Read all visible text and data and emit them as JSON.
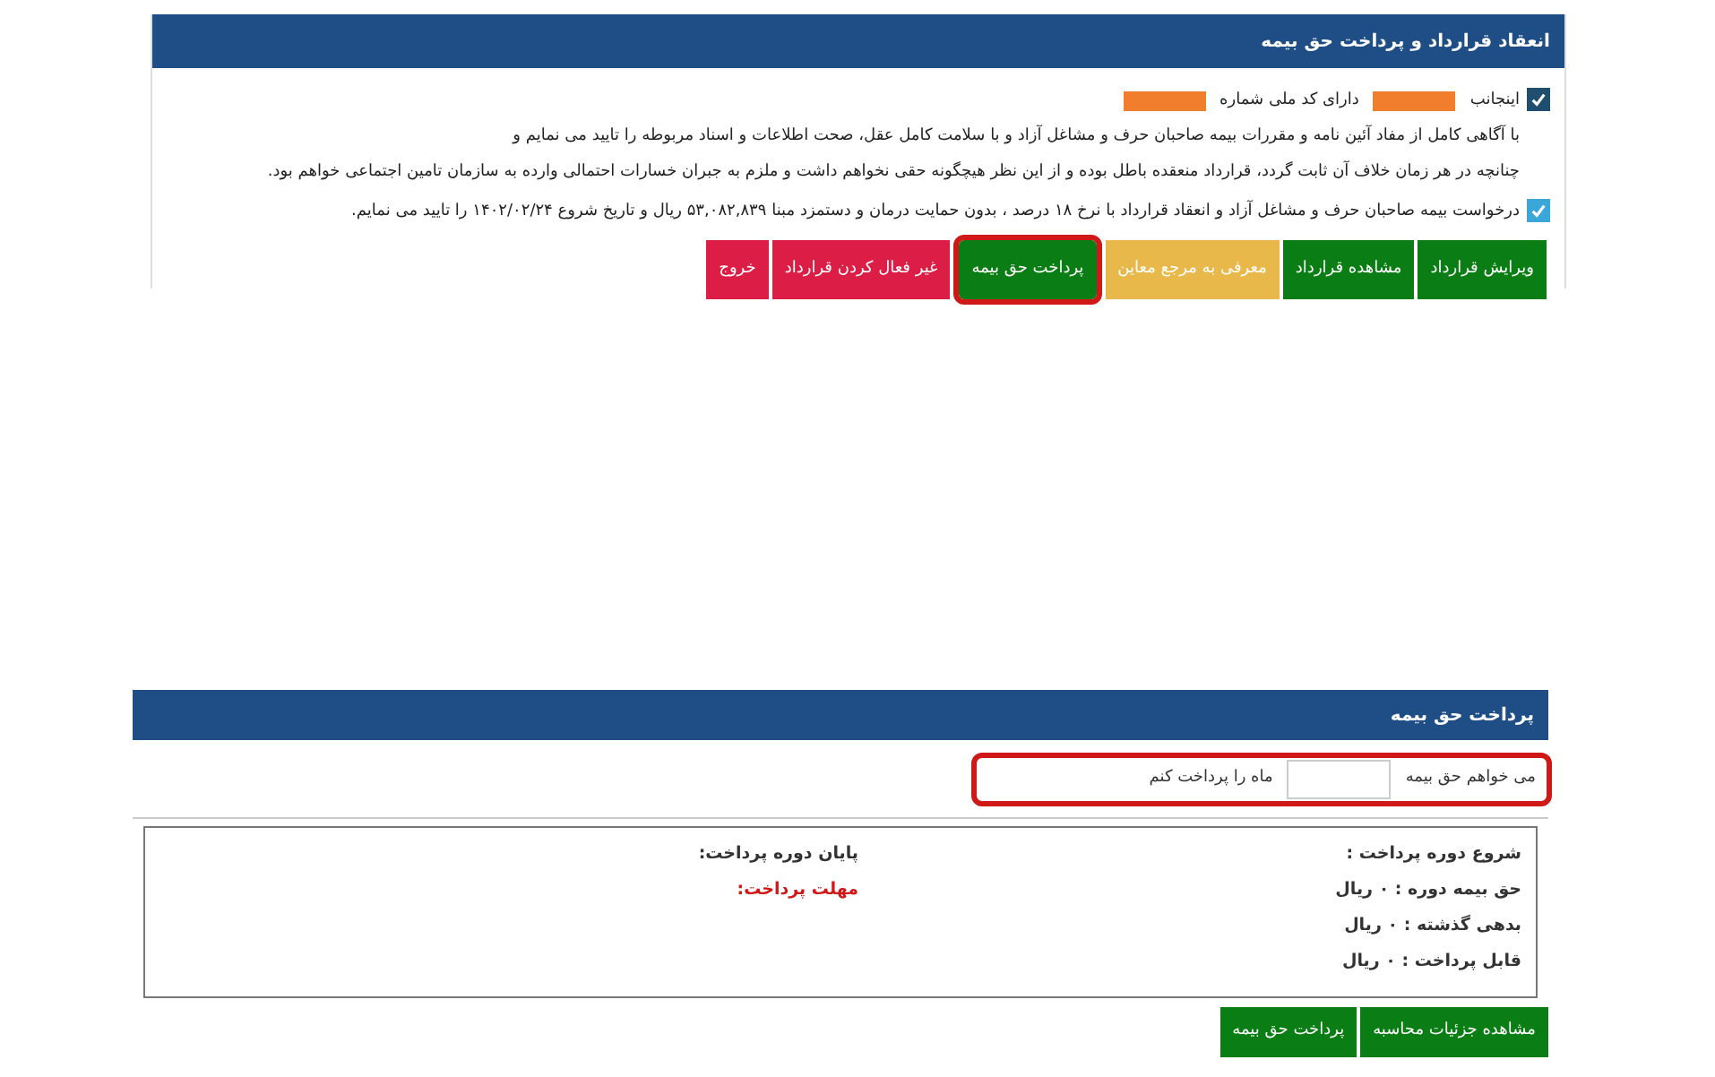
{
  "contract_panel": {
    "title": "انعقاد قرارداد و پرداخت حق بیمه",
    "statements": [
      {
        "checked": true,
        "parts": [
          {
            "kind": "text",
            "text": "اینجانب"
          },
          {
            "kind": "redacted"
          },
          {
            "kind": "text",
            "text": "دارای کد ملی شماره"
          },
          {
            "kind": "redacted"
          },
          {
            "kind": "text",
            "text": "با آگاهی کامل از مفاد آئین نامه و مقررات بیمه صاحبان حرف و مشاغل آزاد و با سلامت کامل عقل، صحت اطلاعات و اسناد مربوطه را تایید می نمایم و"
          },
          {
            "kind": "line",
            "text": "چنانچه در هر زمان خلاف آن ثابت گردد، قرارداد منعقده باطل بوده و از این نظر هیچگونه حقی نخواهم داشت و ملزم به جبران خسارات احتمالی وارده به سازمان تامین اجتماعی خواهم بود."
          }
        ]
      },
      {
        "checked": true,
        "parts": [
          {
            "kind": "text",
            "text": "درخواست بیمه صاحبان حرف و مشاغل آزاد و انعقاد قرارداد با نرخ ۱۸ درصد ، بدون حمایت درمان و دستمزد مبنا ۵۳,۰۸۲,۸۳۹ ریال و تاریخ شروع ۱۴۰۲/۰۲/۲۴ را تایید می نمایم."
          }
        ]
      }
    ],
    "buttons": [
      {
        "label": "ویرایش قرارداد",
        "color": "#0a7d14",
        "highlighted": false
      },
      {
        "label": "مشاهده قرارداد",
        "color": "#0a7d14",
        "highlighted": false
      },
      {
        "label": "معرفی به مرجع معاین",
        "color": "#e8b84a",
        "highlighted": false
      },
      {
        "label": "پرداخت حق بیمه",
        "color": "#0a7d14",
        "highlighted": true
      },
      {
        "label": "غیر فعال کردن قرارداد",
        "color": "#dc1e46",
        "highlighted": false
      },
      {
        "label": "خروج",
        "color": "#dc1e46",
        "highlighted": false
      }
    ]
  },
  "payment_panel": {
    "title": "پرداخت حق بیمه",
    "months_field": {
      "label_before": "می خواهم حق بیمه",
      "label_after": "ماه را پرداخت کنم",
      "highlighted": true
    },
    "info_right": [
      {
        "text": "شروع دوره پرداخت :"
      },
      {
        "text": "حق بیمه دوره : ۰ ریال"
      },
      {
        "text": "بدهی گذشته : ۰ ریال"
      },
      {
        "text": "قابل پرداخت : ۰ ریال"
      }
    ],
    "info_left": [
      {
        "text": "پایان دوره پرداخت:",
        "kind": "normal"
      },
      {
        "text": "مهلت پرداخت:",
        "kind": "alert"
      }
    ],
    "buttons": [
      {
        "label": "مشاهده جزئیات محاسبه",
        "color": "#0a7d14"
      },
      {
        "label": "پرداخت حق بیمه",
        "color": "#0a7d14"
      }
    ]
  }
}
